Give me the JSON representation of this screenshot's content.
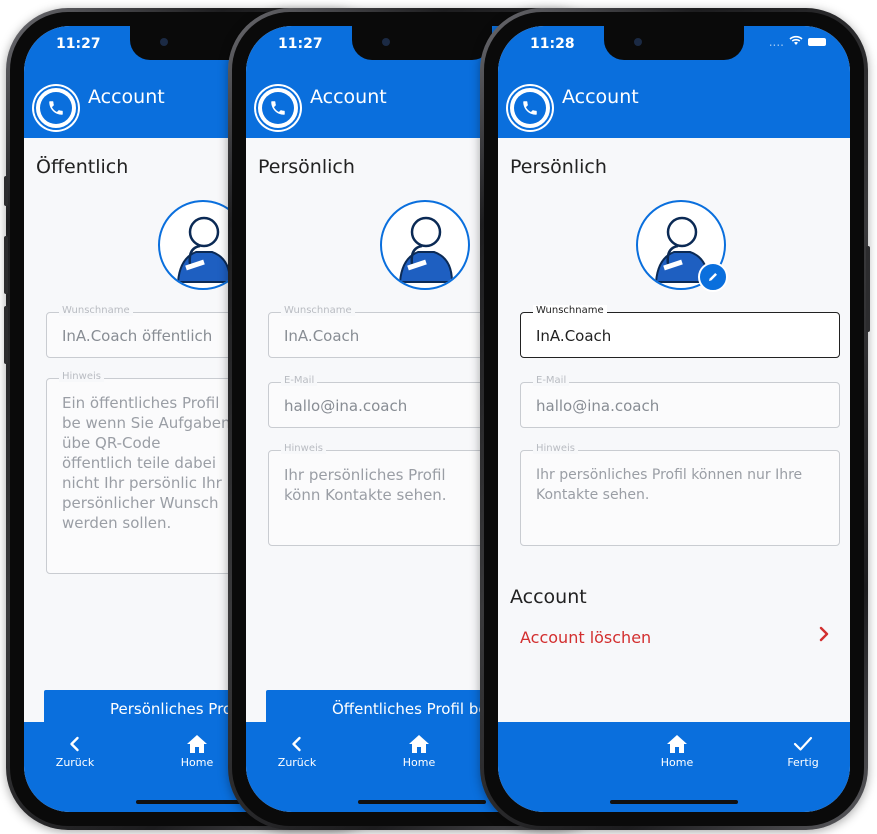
{
  "phone1": {
    "time": "11:27",
    "header": "Account",
    "section_title": "Öffentlich",
    "wunsch_label": "Wunschname",
    "wunsch_value": "InA.Coach öffentlich",
    "hinweis_label": "Hinweis",
    "hinweis_text": "Ein öffentliches Profil be wenn Sie Aufgaben übe QR-Code öffentlich teile dabei nicht Ihr persönlic Ihr persönlicher Wunsch werden sollen.",
    "button_label": "Persönliches Profil",
    "back_label": "Zurück",
    "home_label": "Home"
  },
  "phone2": {
    "time": "11:27",
    "header": "Account",
    "section_title": "Persönlich",
    "wunsch_label": "Wunschname",
    "wunsch_value": "InA.Coach",
    "email_label": "E-Mail",
    "email_value": "hallo@ina.coach",
    "hinweis_label": "Hinweis",
    "hinweis_text": "Ihr persönliches Profil könn Kontakte sehen.",
    "button_label": "Öffentliches Profil be",
    "back_label": "Zurück",
    "home_label": "Home"
  },
  "phone3": {
    "time": "11:28",
    "header": "Account",
    "section_title": "Persönlich",
    "wunsch_label": "Wunschname",
    "wunsch_value": "InA.Coach",
    "email_label": "E-Mail",
    "email_value": "hallo@ina.coach",
    "hinweis_label": "Hinweis",
    "hinweis_text": "Ihr persönliches Profil können nur Ihre Kontakte sehen.",
    "account_section": "Account",
    "delete_label": "Account löschen",
    "home_label": "Home",
    "done_label": "Fertig",
    "status_dots": "...."
  },
  "icons": {
    "logo": "phone-handset-icon",
    "avatar": "coach-avatar-icon",
    "edit": "pencil-icon",
    "back": "chevron-left-icon",
    "home": "home-icon",
    "done": "checkmark-icon",
    "wifi": "wifi-icon",
    "battery": "battery-icon",
    "chevron": "chevron-right-icon"
  },
  "colors": {
    "primary": "#0a6fdd",
    "danger": "#d32f2f",
    "background": "#f7f8fa"
  }
}
